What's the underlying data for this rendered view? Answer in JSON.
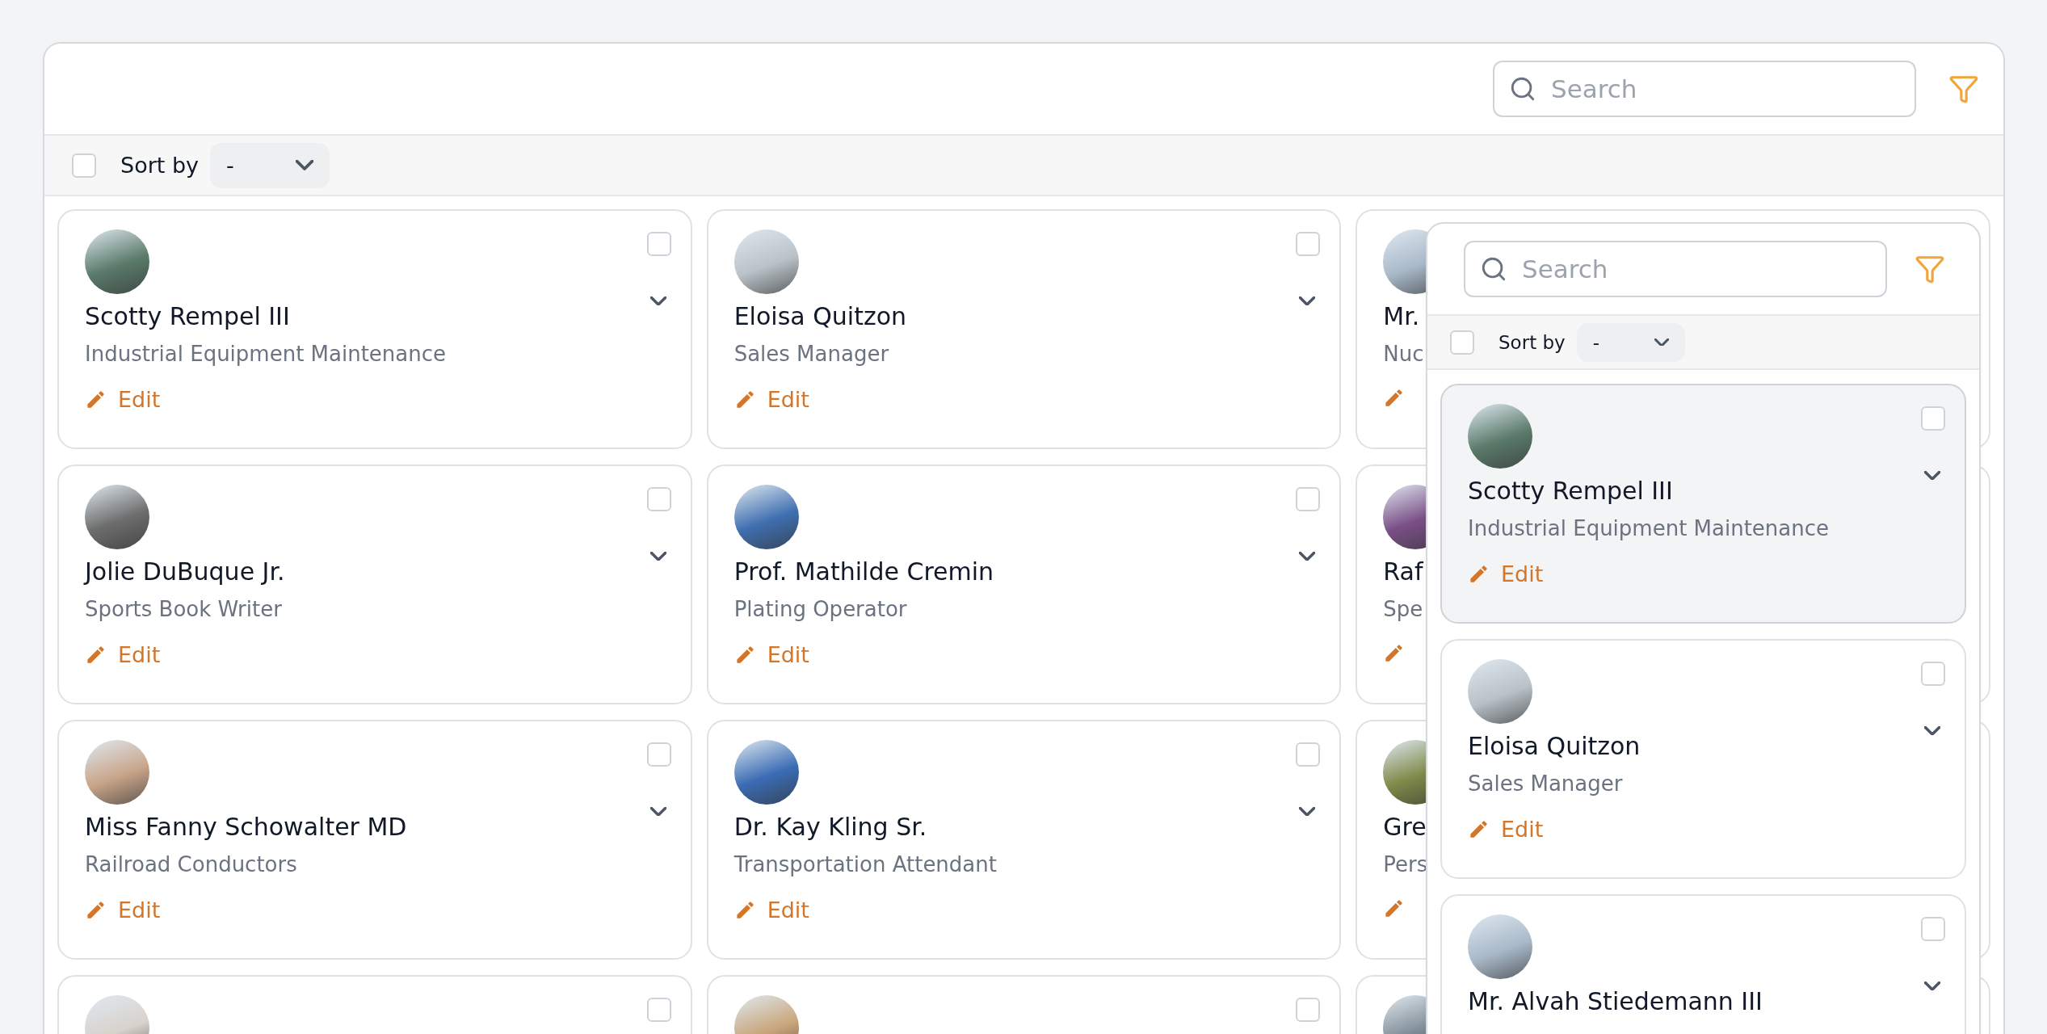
{
  "toolbar": {
    "search": {
      "placeholder": "Search"
    }
  },
  "sort_bar": {
    "checked": false,
    "label": "Sort by",
    "value": "-"
  },
  "cards": [
    {
      "kind": "full",
      "name": "Scotty Rempel III",
      "title": "Industrial Equipment Maintenance",
      "action": "Edit",
      "checked": false
    },
    {
      "kind": "full",
      "name": "Eloisa Quitzon",
      "title": "Sales Manager",
      "action": "Edit",
      "checked": false
    },
    {
      "kind": "covered",
      "name": "Mr.",
      "title": "Nuc"
    },
    {
      "kind": "full",
      "name": "Jolie DuBuque Jr.",
      "title": "Sports Book Writer",
      "action": "Edit",
      "checked": false
    },
    {
      "kind": "full",
      "name": "Prof. Mathilde Cremin",
      "title": "Plating Operator",
      "action": "Edit",
      "checked": false
    },
    {
      "kind": "covered",
      "name": "Raf",
      "title": "Spe"
    },
    {
      "kind": "full",
      "name": "Miss Fanny Schowalter MD",
      "title": "Railroad Conductors",
      "action": "Edit",
      "checked": false
    },
    {
      "kind": "full",
      "name": "Dr. Kay Kling Sr.",
      "title": "Transportation Attendant",
      "action": "Edit",
      "checked": false
    },
    {
      "kind": "covered",
      "name": "Gre",
      "title": "Pers"
    },
    {
      "kind": "full",
      "checked": false
    },
    {
      "kind": "full",
      "checked": false
    },
    {
      "kind": "covered"
    }
  ],
  "panel": {
    "search": {
      "placeholder": "Search"
    },
    "sort_bar": {
      "checked": false,
      "label": "Sort by",
      "value": "-"
    },
    "cards": [
      {
        "kind": "full",
        "name": "Scotty Rempel III",
        "title": "Industrial Equipment Maintenance",
        "action": "Edit",
        "checked": false,
        "highlighted": true
      },
      {
        "kind": "full",
        "name": "Eloisa Quitzon",
        "title": "Sales Manager",
        "action": "Edit",
        "checked": false,
        "highlighted": false
      },
      {
        "kind": "full",
        "name": "Mr. Alvah Stiedemann III",
        "checked": false,
        "highlighted": false
      }
    ]
  }
}
